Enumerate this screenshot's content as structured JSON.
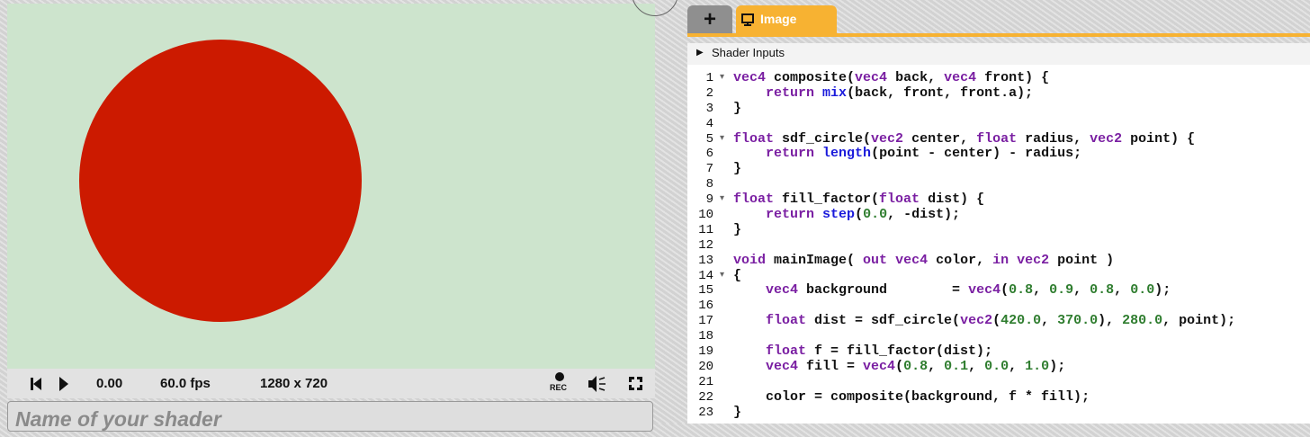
{
  "preview": {
    "background_color": "#cde4cd",
    "circle_color": "#cc1a00",
    "time": "0.00",
    "fps": "60.0 fps",
    "resolution": "1280 x 720",
    "rec_label": "REC"
  },
  "shader_name_placeholder": "Name of your shader",
  "tabs": [
    {
      "label": "+"
    },
    {
      "label": "Image"
    }
  ],
  "shader_inputs_label": "Shader Inputs",
  "code_lines": [
    {
      "n": "1",
      "fold": true,
      "segs": [
        [
          "kw",
          "vec4"
        ],
        [
          "t",
          " composite("
        ],
        [
          "kw",
          "vec4"
        ],
        [
          "t",
          " back, "
        ],
        [
          "kw",
          "vec4"
        ],
        [
          "t",
          " front) {"
        ]
      ]
    },
    {
      "n": "2",
      "fold": false,
      "segs": [
        [
          "t",
          "    "
        ],
        [
          "kw",
          "return"
        ],
        [
          "t",
          " "
        ],
        [
          "fn",
          "mix"
        ],
        [
          "t",
          "(back, front, front.a);"
        ]
      ]
    },
    {
      "n": "3",
      "fold": false,
      "segs": [
        [
          "t",
          "}"
        ]
      ]
    },
    {
      "n": "4",
      "fold": false,
      "segs": []
    },
    {
      "n": "5",
      "fold": true,
      "segs": [
        [
          "kw",
          "float"
        ],
        [
          "t",
          " sdf_circle("
        ],
        [
          "kw",
          "vec2"
        ],
        [
          "t",
          " center, "
        ],
        [
          "kw",
          "float"
        ],
        [
          "t",
          " radius, "
        ],
        [
          "kw",
          "vec2"
        ],
        [
          "t",
          " point) {"
        ]
      ]
    },
    {
      "n": "6",
      "fold": false,
      "segs": [
        [
          "t",
          "    "
        ],
        [
          "kw",
          "return"
        ],
        [
          "t",
          " "
        ],
        [
          "fn",
          "length"
        ],
        [
          "t",
          "(point - center) - radius;"
        ]
      ]
    },
    {
      "n": "7",
      "fold": false,
      "segs": [
        [
          "t",
          "}"
        ]
      ]
    },
    {
      "n": "8",
      "fold": false,
      "segs": []
    },
    {
      "n": "9",
      "fold": true,
      "segs": [
        [
          "kw",
          "float"
        ],
        [
          "t",
          " fill_factor("
        ],
        [
          "kw",
          "float"
        ],
        [
          "t",
          " dist) {"
        ]
      ]
    },
    {
      "n": "10",
      "fold": false,
      "segs": [
        [
          "t",
          "    "
        ],
        [
          "kw",
          "return"
        ],
        [
          "t",
          " "
        ],
        [
          "fn",
          "step"
        ],
        [
          "t",
          "("
        ],
        [
          "nm",
          "0.0"
        ],
        [
          "t",
          ", -dist);"
        ]
      ]
    },
    {
      "n": "11",
      "fold": false,
      "segs": [
        [
          "t",
          "}"
        ]
      ]
    },
    {
      "n": "12",
      "fold": false,
      "segs": []
    },
    {
      "n": "13",
      "fold": false,
      "segs": [
        [
          "kw",
          "void"
        ],
        [
          "t",
          " mainImage( "
        ],
        [
          "kw",
          "out"
        ],
        [
          "t",
          " "
        ],
        [
          "kw",
          "vec4"
        ],
        [
          "t",
          " color, "
        ],
        [
          "kw",
          "in"
        ],
        [
          "t",
          " "
        ],
        [
          "kw",
          "vec2"
        ],
        [
          "t",
          " point )"
        ]
      ]
    },
    {
      "n": "14",
      "fold": true,
      "segs": [
        [
          "t",
          "{"
        ]
      ]
    },
    {
      "n": "15",
      "fold": false,
      "segs": [
        [
          "t",
          "    "
        ],
        [
          "kw",
          "vec4"
        ],
        [
          "t",
          " background        = "
        ],
        [
          "kw",
          "vec4"
        ],
        [
          "t",
          "("
        ],
        [
          "nm",
          "0.8"
        ],
        [
          "t",
          ", "
        ],
        [
          "nm",
          "0.9"
        ],
        [
          "t",
          ", "
        ],
        [
          "nm",
          "0.8"
        ],
        [
          "t",
          ", "
        ],
        [
          "nm",
          "0.0"
        ],
        [
          "t",
          ");"
        ]
      ]
    },
    {
      "n": "16",
      "fold": false,
      "segs": []
    },
    {
      "n": "17",
      "fold": false,
      "segs": [
        [
          "t",
          "    "
        ],
        [
          "kw",
          "float"
        ],
        [
          "t",
          " dist = sdf_circle("
        ],
        [
          "kw",
          "vec2"
        ],
        [
          "t",
          "("
        ],
        [
          "nm",
          "420.0"
        ],
        [
          "t",
          ", "
        ],
        [
          "nm",
          "370.0"
        ],
        [
          "t",
          "), "
        ],
        [
          "nm",
          "280.0"
        ],
        [
          "t",
          ", point);"
        ]
      ]
    },
    {
      "n": "18",
      "fold": false,
      "segs": []
    },
    {
      "n": "19",
      "fold": false,
      "segs": [
        [
          "t",
          "    "
        ],
        [
          "kw",
          "float"
        ],
        [
          "t",
          " f = fill_factor(dist);"
        ]
      ]
    },
    {
      "n": "20",
      "fold": false,
      "segs": [
        [
          "t",
          "    "
        ],
        [
          "kw",
          "vec4"
        ],
        [
          "t",
          " fill = "
        ],
        [
          "kw",
          "vec4"
        ],
        [
          "t",
          "("
        ],
        [
          "nm",
          "0.8"
        ],
        [
          "t",
          ", "
        ],
        [
          "nm",
          "0.1"
        ],
        [
          "t",
          ", "
        ],
        [
          "nm",
          "0.0"
        ],
        [
          "t",
          ", "
        ],
        [
          "nm",
          "1.0"
        ],
        [
          "t",
          ");"
        ]
      ]
    },
    {
      "n": "21",
      "fold": false,
      "segs": []
    },
    {
      "n": "22",
      "fold": false,
      "segs": [
        [
          "t",
          "    color = composite(background, f * fill);"
        ]
      ]
    },
    {
      "n": "23",
      "fold": false,
      "segs": [
        [
          "t",
          "}"
        ]
      ]
    }
  ],
  "colors": {
    "tab_active": "#f7b232",
    "tab_inactive": "#8f8f8f",
    "keyword": "#7a1fa2",
    "builtin_fn": "#1a1adb",
    "number": "#2f7d2f"
  }
}
